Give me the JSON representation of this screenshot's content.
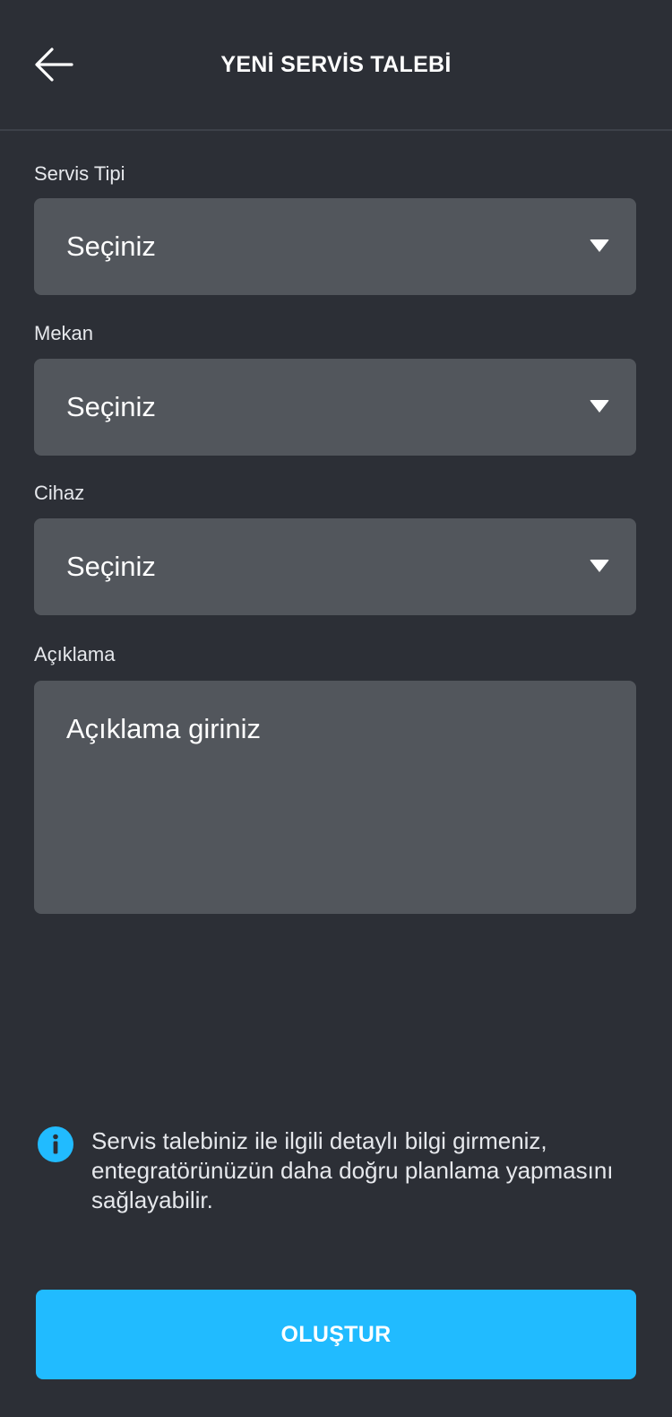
{
  "header": {
    "title": "YENİ SERVİS TALEBİ",
    "back_icon": "arrow-left-icon"
  },
  "form": {
    "service_type": {
      "label": "Servis Tipi",
      "value": "Seçiniz"
    },
    "location": {
      "label": "Mekan",
      "value": "Seçiniz"
    },
    "device": {
      "label": "Cihaz",
      "value": "Seçiniz"
    },
    "description": {
      "label": "Açıklama",
      "placeholder": "Açıklama giriniz"
    }
  },
  "info": {
    "icon": "info-icon",
    "text": "Servis talebiniz ile ilgili detaylı bilgi girmeniz, entegratörünüzün daha doğru planlama yapmasını sağlayabilir."
  },
  "submit": {
    "label": "OLUŞTUR"
  },
  "colors": {
    "background": "#2c2f36",
    "field_background": "#52565c",
    "accent": "#21bbff",
    "info_icon": "#21bbff"
  }
}
